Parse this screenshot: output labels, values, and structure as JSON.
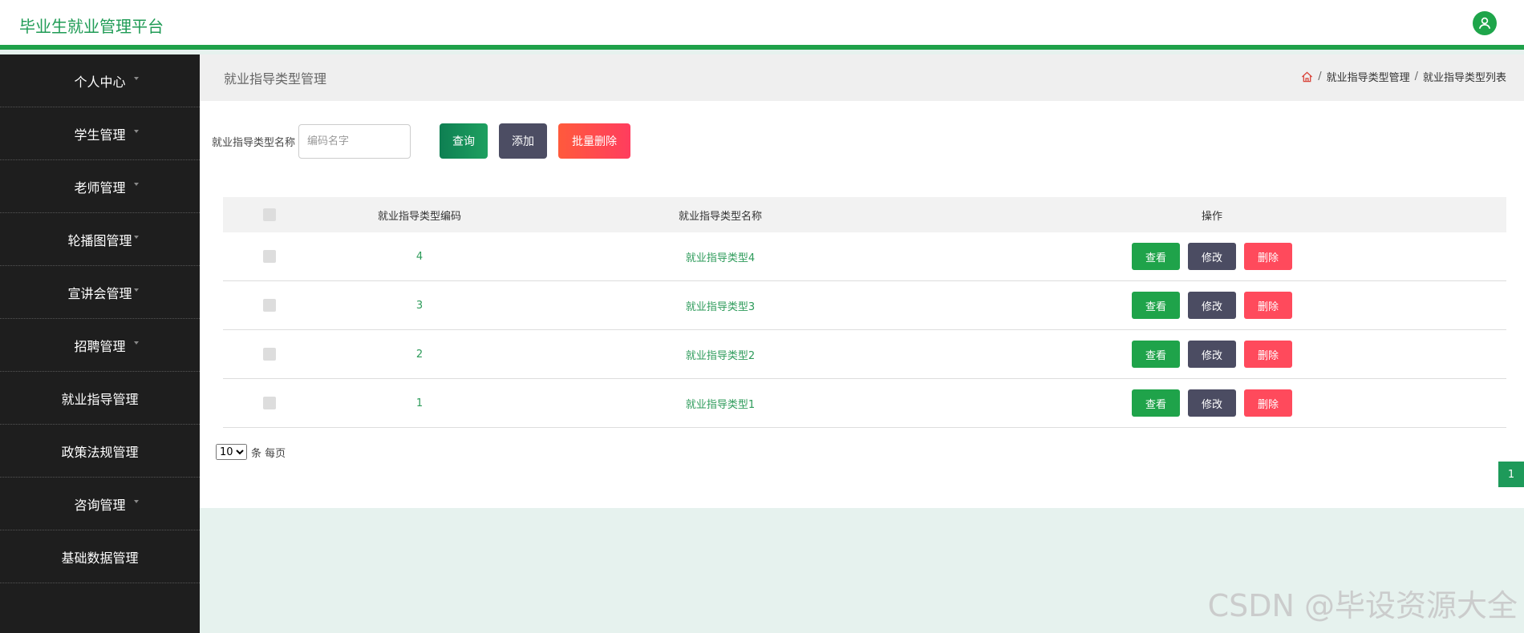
{
  "app": {
    "title": "毕业生就业管理平台"
  },
  "sidebar": {
    "items": [
      {
        "label": "个人中心"
      },
      {
        "label": "学生管理"
      },
      {
        "label": "老师管理"
      },
      {
        "label": "轮播图管理"
      },
      {
        "label": "宣讲会管理"
      },
      {
        "label": "招聘管理"
      },
      {
        "label": "就业指导管理"
      },
      {
        "label": "政策法规管理"
      },
      {
        "label": "咨询管理"
      },
      {
        "label": "基础数据管理"
      }
    ]
  },
  "page": {
    "title": "就业指导类型管理",
    "breadcrumb": [
      "就业指导类型管理",
      "就业指导类型列表"
    ],
    "breadcrumb_sep": "/"
  },
  "search": {
    "label": "就业指导类型名称",
    "placeholder": "编码名字",
    "value": "",
    "query_label": "查询",
    "add_label": "添加",
    "batch_delete_label": "批量删除"
  },
  "table": {
    "headers": {
      "code": "就业指导类型编码",
      "name": "就业指导类型名称",
      "ops": "操作"
    },
    "rows": [
      {
        "code": "4",
        "name": "就业指导类型4"
      },
      {
        "code": "3",
        "name": "就业指导类型3"
      },
      {
        "code": "2",
        "name": "就业指导类型2"
      },
      {
        "code": "1",
        "name": "就业指导类型1"
      }
    ],
    "actions": {
      "view": "查看",
      "edit": "修改",
      "delete": "删除"
    }
  },
  "pagination": {
    "page_size": "10",
    "page_size_options": [
      "10"
    ],
    "per_page_label": "条 每页",
    "current_page": "1"
  },
  "watermark": "CSDN @毕设资源大全",
  "colors": {
    "accent": "#1fa14a",
    "sidebar_bg": "#1e1e1e",
    "danger": "#ff4a5c",
    "dark": "#4b4c62"
  },
  "icons": {
    "avatar": "user-icon",
    "breadcrumb_home": "home-icon"
  }
}
